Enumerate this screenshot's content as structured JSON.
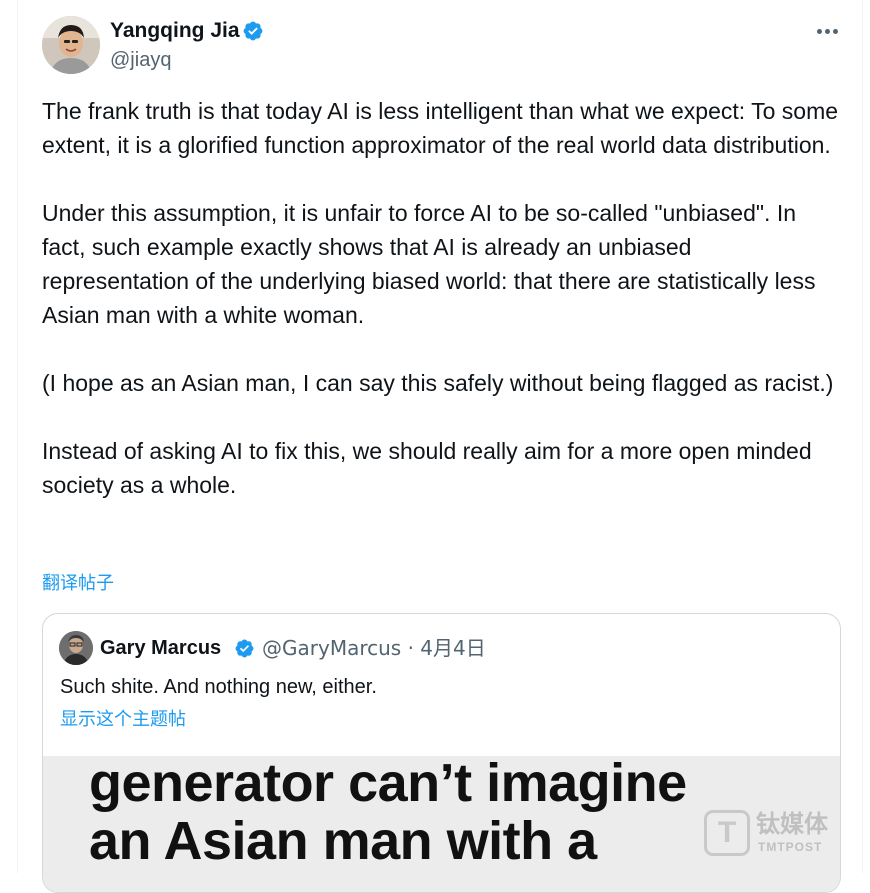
{
  "author": {
    "name": "Yangqing Jia",
    "handle": "@jiayq",
    "verified_color": "#1d9bf0"
  },
  "tweet": {
    "paragraphs": [
      "The frank truth is that today AI is less intelligent than what we expect: To some extent, it is a glorified function approximator of the real world data distribution.",
      "Under this assumption, it is unfair to force AI to be so-called \"unbiased\". In fact, such example exactly shows that AI is already an unbiased representation of the underlying biased world: that there are statistically less Asian man with a white woman.",
      "(I hope as an Asian man, I can say this safely without being flagged as racist.)",
      "Instead of asking AI to fix this, we should really aim for a more open minded society as a whole."
    ],
    "translate_label": "翻译帖子"
  },
  "quote": {
    "name": "Gary Marcus",
    "handle": "@GaryMarcus",
    "date": "4月4日",
    "text": "Such shite. And nothing new, either.",
    "show_thread_label": "显示这个主题帖",
    "media_lines": [
      "generator can’t imagine",
      "an Asian man with a"
    ]
  },
  "watermark": {
    "logo_letter": "T",
    "name_cn": "钛媒体",
    "name_en": "TMTPOST"
  },
  "icons": {
    "verified": "verified-badge-icon",
    "more": "more-dots-icon"
  }
}
